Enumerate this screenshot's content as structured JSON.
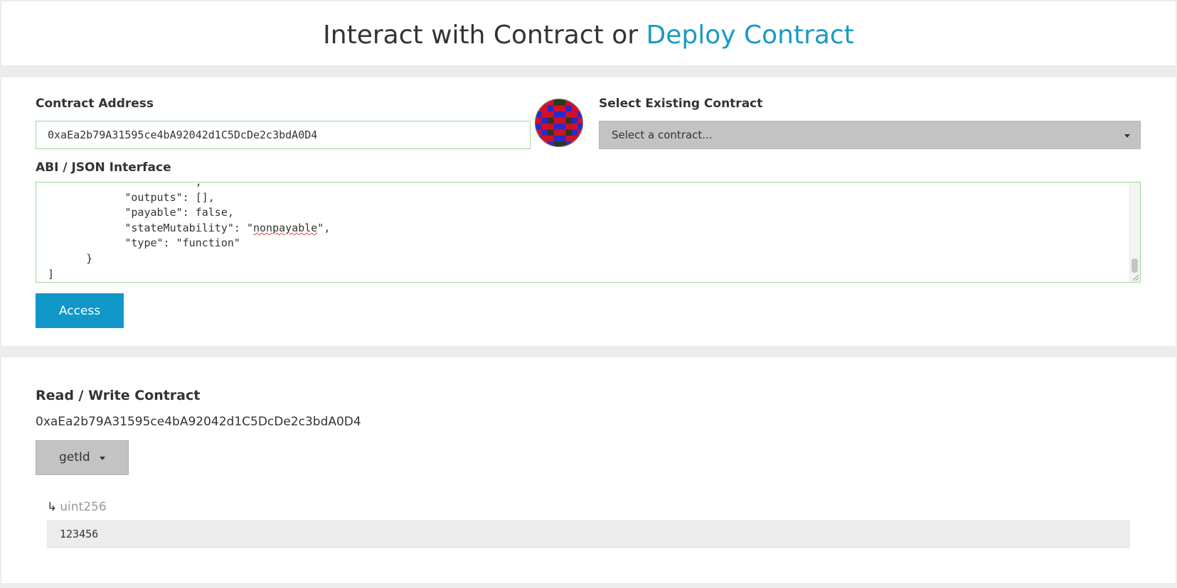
{
  "header": {
    "title_main": "Interact with Contract",
    "title_or": "or",
    "title_link": "Deploy Contract"
  },
  "form": {
    "contract_address_label": "Contract Address",
    "contract_address_value": "0xaEa2b79A31595ce4bA92042d1C5DcDe2c3bdA0D4",
    "select_label": "Select Existing Contract",
    "select_placeholder": "Select a contract...",
    "abi_label": "ABI / JSON Interface",
    "abi_lines": [
      "            \"outputs\": [],",
      "            \"payable\": false,",
      "            \"stateMutability\": \"",
      "nonpayable",
      "\",",
      "            \"type\": \"function\"",
      "      }",
      "]"
    ],
    "access_button": "Access"
  },
  "read_write": {
    "title": "Read / Write Contract",
    "address": "0xaEa2b79A31595ce4bA92042d1C5DcDe2c3bdA0D4",
    "function_selected": "getId",
    "output_arrow": "↳",
    "output_type": "uint256",
    "output_value": "123456"
  },
  "colors": {
    "accent": "#1198c9",
    "link": "#1a9ac3",
    "input_border": "#9fd99f",
    "dropdown_bg": "#c3c3c3",
    "identicon_red": "#d0102a",
    "identicon_blue": "#2a2ac8",
    "identicon_dark": "#2a3a1a"
  },
  "icons": {
    "identicon": "identicon-avatar",
    "select_caret": "caret-down-icon",
    "return_arrow": "return-arrow-icon"
  }
}
